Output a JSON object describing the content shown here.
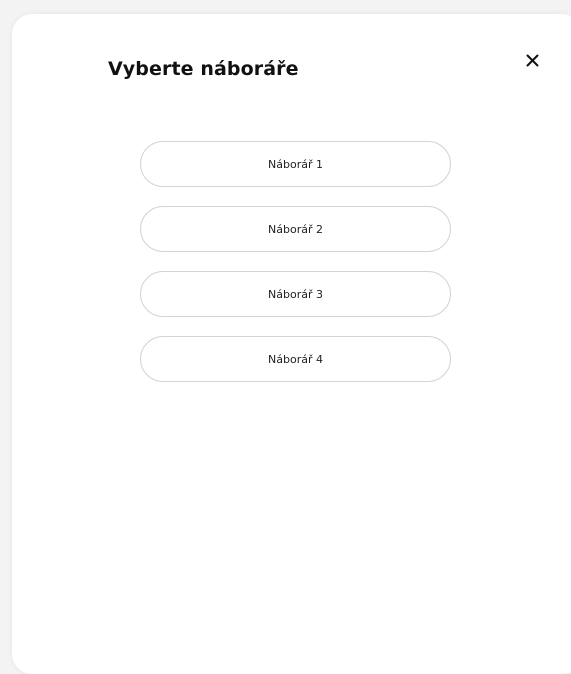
{
  "dialog": {
    "title": "Vyberte náboráře",
    "close_icon": "close-icon"
  },
  "options": [
    {
      "label": "Náborář 1"
    },
    {
      "label": "Náborář 2"
    },
    {
      "label": "Náborář 3"
    },
    {
      "label": "Náborář 4"
    }
  ],
  "colors": {
    "background": "#f3f3f3",
    "surface": "#ffffff",
    "text": "#111111",
    "border": "#d4d4d4"
  }
}
